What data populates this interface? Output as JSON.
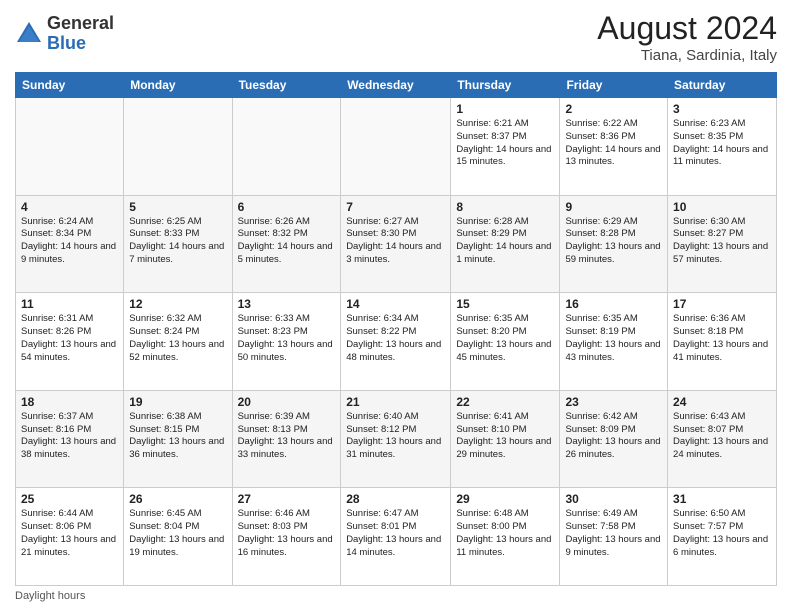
{
  "logo": {
    "general": "General",
    "blue": "Blue"
  },
  "title": {
    "month_year": "August 2024",
    "location": "Tiana, Sardinia, Italy"
  },
  "header_days": [
    "Sunday",
    "Monday",
    "Tuesday",
    "Wednesday",
    "Thursday",
    "Friday",
    "Saturday"
  ],
  "weeks": [
    [
      {
        "day": "",
        "info": ""
      },
      {
        "day": "",
        "info": ""
      },
      {
        "day": "",
        "info": ""
      },
      {
        "day": "",
        "info": ""
      },
      {
        "day": "1",
        "info": "Sunrise: 6:21 AM\nSunset: 8:37 PM\nDaylight: 14 hours\nand 15 minutes."
      },
      {
        "day": "2",
        "info": "Sunrise: 6:22 AM\nSunset: 8:36 PM\nDaylight: 14 hours\nand 13 minutes."
      },
      {
        "day": "3",
        "info": "Sunrise: 6:23 AM\nSunset: 8:35 PM\nDaylight: 14 hours\nand 11 minutes."
      }
    ],
    [
      {
        "day": "4",
        "info": "Sunrise: 6:24 AM\nSunset: 8:34 PM\nDaylight: 14 hours\nand 9 minutes."
      },
      {
        "day": "5",
        "info": "Sunrise: 6:25 AM\nSunset: 8:33 PM\nDaylight: 14 hours\nand 7 minutes."
      },
      {
        "day": "6",
        "info": "Sunrise: 6:26 AM\nSunset: 8:32 PM\nDaylight: 14 hours\nand 5 minutes."
      },
      {
        "day": "7",
        "info": "Sunrise: 6:27 AM\nSunset: 8:30 PM\nDaylight: 14 hours\nand 3 minutes."
      },
      {
        "day": "8",
        "info": "Sunrise: 6:28 AM\nSunset: 8:29 PM\nDaylight: 14 hours\nand 1 minute."
      },
      {
        "day": "9",
        "info": "Sunrise: 6:29 AM\nSunset: 8:28 PM\nDaylight: 13 hours\nand 59 minutes."
      },
      {
        "day": "10",
        "info": "Sunrise: 6:30 AM\nSunset: 8:27 PM\nDaylight: 13 hours\nand 57 minutes."
      }
    ],
    [
      {
        "day": "11",
        "info": "Sunrise: 6:31 AM\nSunset: 8:26 PM\nDaylight: 13 hours\nand 54 minutes."
      },
      {
        "day": "12",
        "info": "Sunrise: 6:32 AM\nSunset: 8:24 PM\nDaylight: 13 hours\nand 52 minutes."
      },
      {
        "day": "13",
        "info": "Sunrise: 6:33 AM\nSunset: 8:23 PM\nDaylight: 13 hours\nand 50 minutes."
      },
      {
        "day": "14",
        "info": "Sunrise: 6:34 AM\nSunset: 8:22 PM\nDaylight: 13 hours\nand 48 minutes."
      },
      {
        "day": "15",
        "info": "Sunrise: 6:35 AM\nSunset: 8:20 PM\nDaylight: 13 hours\nand 45 minutes."
      },
      {
        "day": "16",
        "info": "Sunrise: 6:35 AM\nSunset: 8:19 PM\nDaylight: 13 hours\nand 43 minutes."
      },
      {
        "day": "17",
        "info": "Sunrise: 6:36 AM\nSunset: 8:18 PM\nDaylight: 13 hours\nand 41 minutes."
      }
    ],
    [
      {
        "day": "18",
        "info": "Sunrise: 6:37 AM\nSunset: 8:16 PM\nDaylight: 13 hours\nand 38 minutes."
      },
      {
        "day": "19",
        "info": "Sunrise: 6:38 AM\nSunset: 8:15 PM\nDaylight: 13 hours\nand 36 minutes."
      },
      {
        "day": "20",
        "info": "Sunrise: 6:39 AM\nSunset: 8:13 PM\nDaylight: 13 hours\nand 33 minutes."
      },
      {
        "day": "21",
        "info": "Sunrise: 6:40 AM\nSunset: 8:12 PM\nDaylight: 13 hours\nand 31 minutes."
      },
      {
        "day": "22",
        "info": "Sunrise: 6:41 AM\nSunset: 8:10 PM\nDaylight: 13 hours\nand 29 minutes."
      },
      {
        "day": "23",
        "info": "Sunrise: 6:42 AM\nSunset: 8:09 PM\nDaylight: 13 hours\nand 26 minutes."
      },
      {
        "day": "24",
        "info": "Sunrise: 6:43 AM\nSunset: 8:07 PM\nDaylight: 13 hours\nand 24 minutes."
      }
    ],
    [
      {
        "day": "25",
        "info": "Sunrise: 6:44 AM\nSunset: 8:06 PM\nDaylight: 13 hours\nand 21 minutes."
      },
      {
        "day": "26",
        "info": "Sunrise: 6:45 AM\nSunset: 8:04 PM\nDaylight: 13 hours\nand 19 minutes."
      },
      {
        "day": "27",
        "info": "Sunrise: 6:46 AM\nSunset: 8:03 PM\nDaylight: 13 hours\nand 16 minutes."
      },
      {
        "day": "28",
        "info": "Sunrise: 6:47 AM\nSunset: 8:01 PM\nDaylight: 13 hours\nand 14 minutes."
      },
      {
        "day": "29",
        "info": "Sunrise: 6:48 AM\nSunset: 8:00 PM\nDaylight: 13 hours\nand 11 minutes."
      },
      {
        "day": "30",
        "info": "Sunrise: 6:49 AM\nSunset: 7:58 PM\nDaylight: 13 hours\nand 9 minutes."
      },
      {
        "day": "31",
        "info": "Sunrise: 6:50 AM\nSunset: 7:57 PM\nDaylight: 13 hours\nand 6 minutes."
      }
    ]
  ],
  "footer": "Daylight hours"
}
